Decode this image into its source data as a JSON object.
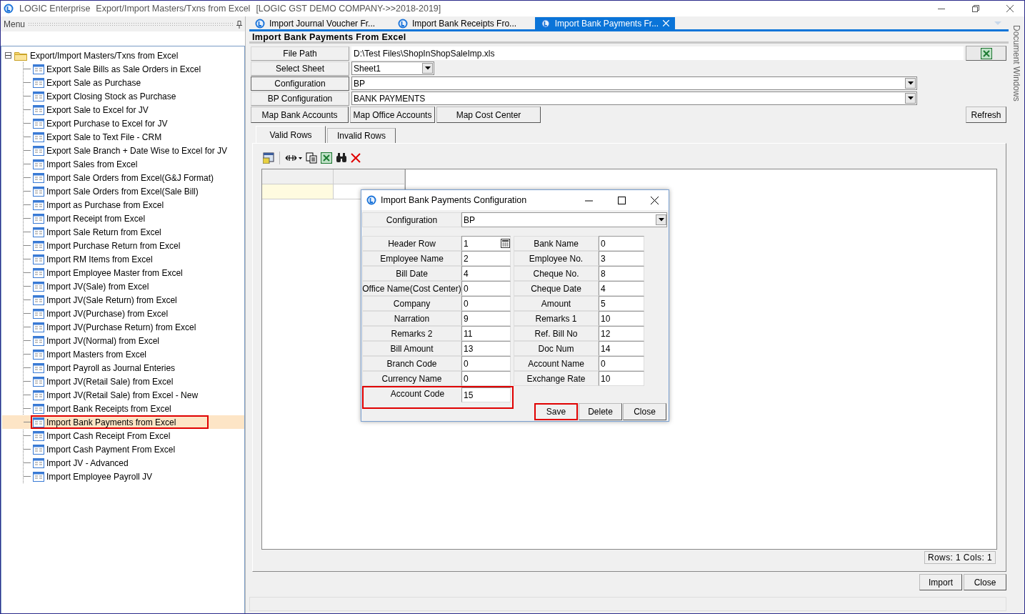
{
  "window": {
    "app_name": "LOGIC Enterprise",
    "module": "Export/Import Masters/Txns from Excel",
    "company": "[LOGIC GST DEMO COMPANY->>2018-2019]"
  },
  "menu": {
    "title": "Menu"
  },
  "tree": {
    "label": "Export/Import Masters/Txns from Excel",
    "expanded": true,
    "children": [
      {
        "label": "Export Sale Bills as Sale Orders in Excel",
        "selected": false,
        "highlighted": false
      },
      {
        "label": "Export Sale as Purchase",
        "selected": false,
        "highlighted": false
      },
      {
        "label": "Export Closing Stock as Purchase",
        "selected": false,
        "highlighted": false
      },
      {
        "label": "Export Sale to Excel for JV",
        "selected": false,
        "highlighted": false
      },
      {
        "label": "Export Purchase to Excel for JV",
        "selected": false,
        "highlighted": false
      },
      {
        "label": "Export Sale to Text File - CRM",
        "selected": false,
        "highlighted": false
      },
      {
        "label": "Export Sale Branch + Date Wise to Excel for JV",
        "selected": false,
        "highlighted": false
      },
      {
        "label": "Import Sales from Excel",
        "selected": false,
        "highlighted": false
      },
      {
        "label": "Import Sale Orders from Excel(G&J Format)",
        "selected": false,
        "highlighted": false
      },
      {
        "label": "Import Sale Orders from Excel(Sale Bill)",
        "selected": false,
        "highlighted": false
      },
      {
        "label": "Import as Purchase from Excel",
        "selected": false,
        "highlighted": false
      },
      {
        "label": "Import Receipt from Excel",
        "selected": false,
        "highlighted": false
      },
      {
        "label": "Import Sale Return from Excel",
        "selected": false,
        "highlighted": false
      },
      {
        "label": "Import Purchase Return from Excel",
        "selected": false,
        "highlighted": false
      },
      {
        "label": "Import RM Items from Excel",
        "selected": false,
        "highlighted": false
      },
      {
        "label": "Import Employee Master from Excel",
        "selected": false,
        "highlighted": false
      },
      {
        "label": "Import JV(Sale) from Excel",
        "selected": false,
        "highlighted": false
      },
      {
        "label": "Import JV(Sale Return) from Excel",
        "selected": false,
        "highlighted": false
      },
      {
        "label": "Import JV(Purchase) from Excel",
        "selected": false,
        "highlighted": false
      },
      {
        "label": "Import JV(Purchase Return) from Excel",
        "selected": false,
        "highlighted": false
      },
      {
        "label": "Import JV(Normal) from Excel",
        "selected": false,
        "highlighted": false
      },
      {
        "label": "Import Masters from Excel",
        "selected": false,
        "highlighted": false
      },
      {
        "label": "Import Payroll as Journal Enteries",
        "selected": false,
        "highlighted": false
      },
      {
        "label": "Import JV(Retail Sale) from Excel",
        "selected": false,
        "highlighted": false
      },
      {
        "label": "Import JV(Retail Sale) from Excel - New",
        "selected": false,
        "highlighted": false
      },
      {
        "label": "Import Bank Receipts from Excel",
        "selected": false,
        "highlighted": false
      },
      {
        "label": "Import Bank Payments from Excel",
        "selected": true,
        "highlighted": true
      },
      {
        "label": "Import Cash Receipt From Excel",
        "selected": false,
        "highlighted": false
      },
      {
        "label": "Import Cash Payment From Excel",
        "selected": false,
        "highlighted": false
      },
      {
        "label": "Import JV - Advanced",
        "selected": false,
        "highlighted": false
      },
      {
        "label": "Import Employee Payroll JV",
        "selected": false,
        "highlighted": false
      }
    ]
  },
  "document_tabs": [
    {
      "label": "Import Journal Voucher Fr...",
      "selected": false
    },
    {
      "label": "Import Bank Receipts Fro...",
      "selected": false
    },
    {
      "label": "Import Bank Payments Fr...",
      "selected": true
    }
  ],
  "side_panel": {
    "label": "Document Windows"
  },
  "form": {
    "title": "Import Bank Payments From Excel",
    "rows": [
      {
        "kind": "file",
        "label": "File Path",
        "value": "D:\\Test Files\\ShopInShopSaleImp.xls"
      },
      {
        "kind": "sheet",
        "label": "Select Sheet",
        "value": "Sheet1"
      },
      {
        "kind": "dropdown",
        "label": "Configuration",
        "value": "BP"
      },
      {
        "kind": "dropdown",
        "label": "BP Configuration",
        "value": "BANK PAYMENTS"
      }
    ],
    "map_buttons": [
      "Map Bank Accounts",
      "Map Office Accounts",
      "Map Cost Center"
    ],
    "refresh_button": "Refresh",
    "tabs": [
      {
        "label": "Valid Rows",
        "selected": true
      },
      {
        "label": "Invalid Rows",
        "selected": false
      }
    ],
    "grid_status": "Rows: 1  Cols: 1",
    "buttons": [
      "Import",
      "Close"
    ]
  },
  "dialog": {
    "title": "Import Bank Payments Configuration",
    "configuration": {
      "label": "Configuration",
      "value": "BP"
    },
    "fields": [
      {
        "label": "Header Row",
        "value": "1",
        "kind": "calculator",
        "highlighted": false
      },
      {
        "label": "Bank Name",
        "value": "0",
        "kind": "text",
        "highlighted": false
      },
      {
        "label": "Employee Name",
        "value": "2",
        "kind": "text",
        "highlighted": false
      },
      {
        "label": "Employee No.",
        "value": "3",
        "kind": "text",
        "highlighted": false
      },
      {
        "label": "Bill Date",
        "value": "4",
        "kind": "text",
        "highlighted": false
      },
      {
        "label": "Cheque No.",
        "value": "8",
        "kind": "text",
        "highlighted": false
      },
      {
        "label": "Office Name(Cost Center)",
        "value": "0",
        "kind": "text",
        "highlighted": false
      },
      {
        "label": "Cheque Date",
        "value": "4",
        "kind": "text",
        "highlighted": false
      },
      {
        "label": "Company",
        "value": "0",
        "kind": "text",
        "highlighted": false
      },
      {
        "label": "Amount",
        "value": "5",
        "kind": "text",
        "highlighted": false
      },
      {
        "label": "Narration",
        "value": "9",
        "kind": "text",
        "highlighted": false
      },
      {
        "label": "Remarks 1",
        "value": "10",
        "kind": "text",
        "highlighted": false
      },
      {
        "label": "Remarks 2",
        "value": "11",
        "kind": "text",
        "highlighted": false
      },
      {
        "label": "Ref. Bill No",
        "value": "12",
        "kind": "text",
        "highlighted": false
      },
      {
        "label": "Bill Amount",
        "value": "13",
        "kind": "text",
        "highlighted": false
      },
      {
        "label": "Doc Num",
        "value": "14",
        "kind": "text",
        "highlighted": false
      },
      {
        "label": "Branch Code",
        "value": "0",
        "kind": "text",
        "highlighted": false
      },
      {
        "label": "Account Name",
        "value": "0",
        "kind": "text",
        "highlighted": false
      },
      {
        "label": "Currency Name",
        "value": "0",
        "kind": "text",
        "highlighted": false
      },
      {
        "label": "Exchange Rate",
        "value": "10",
        "kind": "text",
        "highlighted": false
      },
      {
        "label": "Account Code",
        "value": "15",
        "kind": "text",
        "highlighted": true
      }
    ],
    "buttons": [
      {
        "label": "Save",
        "highlighted": true
      },
      {
        "label": "Delete",
        "highlighted": false
      },
      {
        "label": "Close",
        "highlighted": false
      }
    ]
  }
}
